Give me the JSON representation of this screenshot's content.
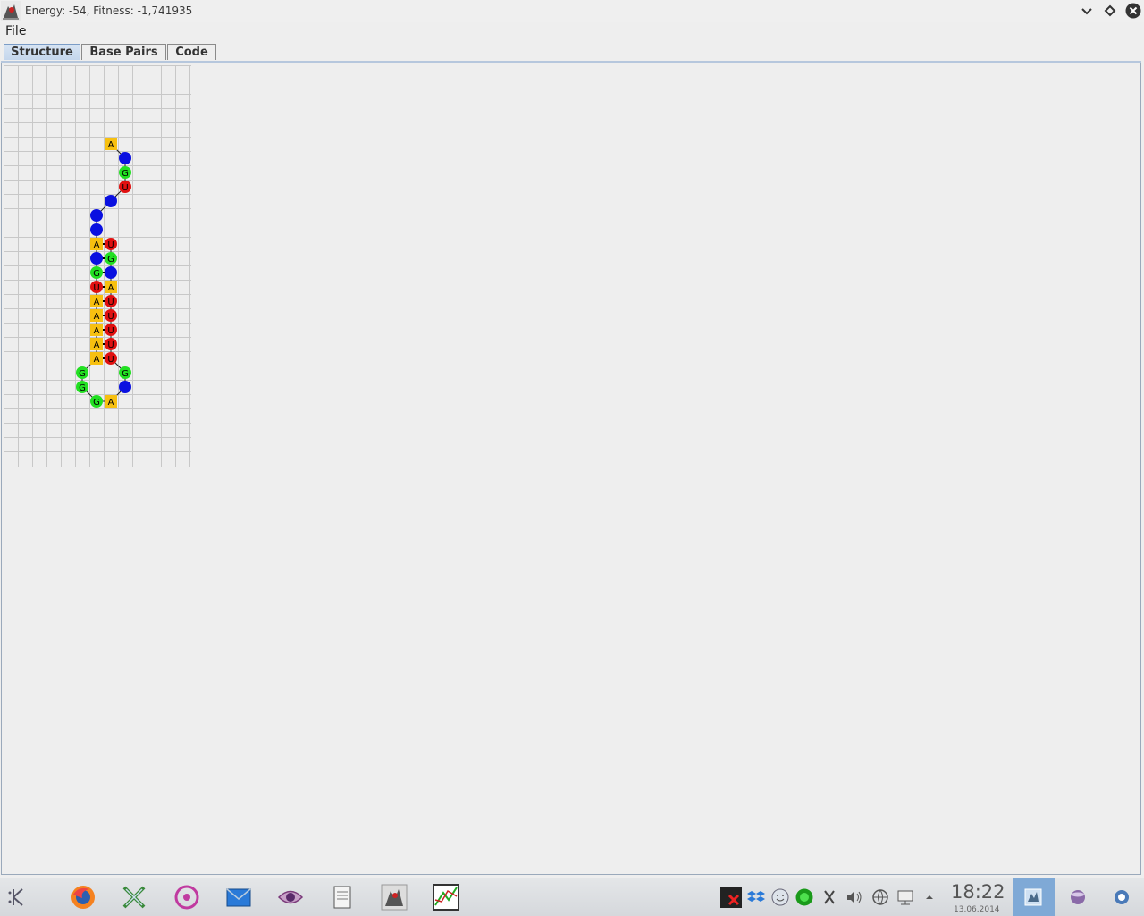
{
  "window": {
    "title": "Energy: -54, Fitness: -1,741935",
    "icon": "java-app-icon",
    "controls": [
      "minimize-icon",
      "maximize-icon",
      "close-icon"
    ]
  },
  "menu": {
    "file_label": "File"
  },
  "tabs": [
    {
      "label": "Structure",
      "active": true
    },
    {
      "label": "Base Pairs",
      "active": false
    },
    {
      "label": "Code",
      "active": false
    }
  ],
  "structure": {
    "nucleotides": [
      {
        "base": "A",
        "col": 7,
        "row": 5
      },
      {
        "base": "C",
        "col": 8,
        "row": 6
      },
      {
        "base": "G",
        "col": 8,
        "row": 7
      },
      {
        "base": "U",
        "col": 8,
        "row": 8
      },
      {
        "base": "C",
        "col": 7,
        "row": 9
      },
      {
        "base": "C",
        "col": 6,
        "row": 10
      },
      {
        "base": "C",
        "col": 6,
        "row": 11
      },
      {
        "base": "A",
        "col": 6,
        "row": 12
      },
      {
        "base": "C",
        "col": 6,
        "row": 13
      },
      {
        "base": "G",
        "col": 6,
        "row": 14
      },
      {
        "base": "U",
        "col": 6,
        "row": 15
      },
      {
        "base": "A",
        "col": 6,
        "row": 16
      },
      {
        "base": "A",
        "col": 6,
        "row": 17
      },
      {
        "base": "A",
        "col": 6,
        "row": 18
      },
      {
        "base": "A",
        "col": 6,
        "row": 19
      },
      {
        "base": "A",
        "col": 6,
        "row": 20
      },
      {
        "base": "G",
        "col": 5,
        "row": 21
      },
      {
        "base": "G",
        "col": 5,
        "row": 22
      },
      {
        "base": "G",
        "col": 6,
        "row": 23
      },
      {
        "base": "A",
        "col": 7,
        "row": 23
      },
      {
        "base": "C",
        "col": 8,
        "row": 22
      },
      {
        "base": "G",
        "col": 8,
        "row": 21
      },
      {
        "base": "U",
        "col": 7,
        "row": 20
      },
      {
        "base": "U",
        "col": 7,
        "row": 19
      },
      {
        "base": "U",
        "col": 7,
        "row": 18
      },
      {
        "base": "U",
        "col": 7,
        "row": 17
      },
      {
        "base": "U",
        "col": 7,
        "row": 16
      },
      {
        "base": "A",
        "col": 7,
        "row": 15
      },
      {
        "base": "C",
        "col": 7,
        "row": 14
      },
      {
        "base": "G",
        "col": 7,
        "row": 13
      },
      {
        "base": "U",
        "col": 7,
        "row": 12
      }
    ],
    "pairs": [
      [
        7,
        30
      ],
      [
        8,
        29
      ],
      [
        9,
        28
      ],
      [
        10,
        27
      ],
      [
        11,
        26
      ],
      [
        12,
        25
      ],
      [
        13,
        24
      ],
      [
        14,
        23
      ],
      [
        15,
        22
      ]
    ],
    "colors": {
      "A": "#f7c010",
      "C": "#0a10e0",
      "G": "#22e022",
      "U": "#e01010"
    },
    "grid": {
      "cols": 13,
      "rows": 28
    }
  },
  "taskbar": {
    "apps": [
      "kde-menu-icon",
      "firefox-icon",
      "xmind-icon",
      "music-player-icon",
      "mail-icon",
      "eye-icon",
      "document-viewer-icon",
      "java-app-icon",
      "plot-icon"
    ],
    "tray": [
      "red-x-icon",
      "dropbox-icon",
      "smiley-icon",
      "green-circle-icon",
      "scissors-icon",
      "volume-icon",
      "network-icon",
      "monitor-icon",
      "arrow-up-icon"
    ],
    "time": "18:22",
    "date": "13.06.2014"
  }
}
